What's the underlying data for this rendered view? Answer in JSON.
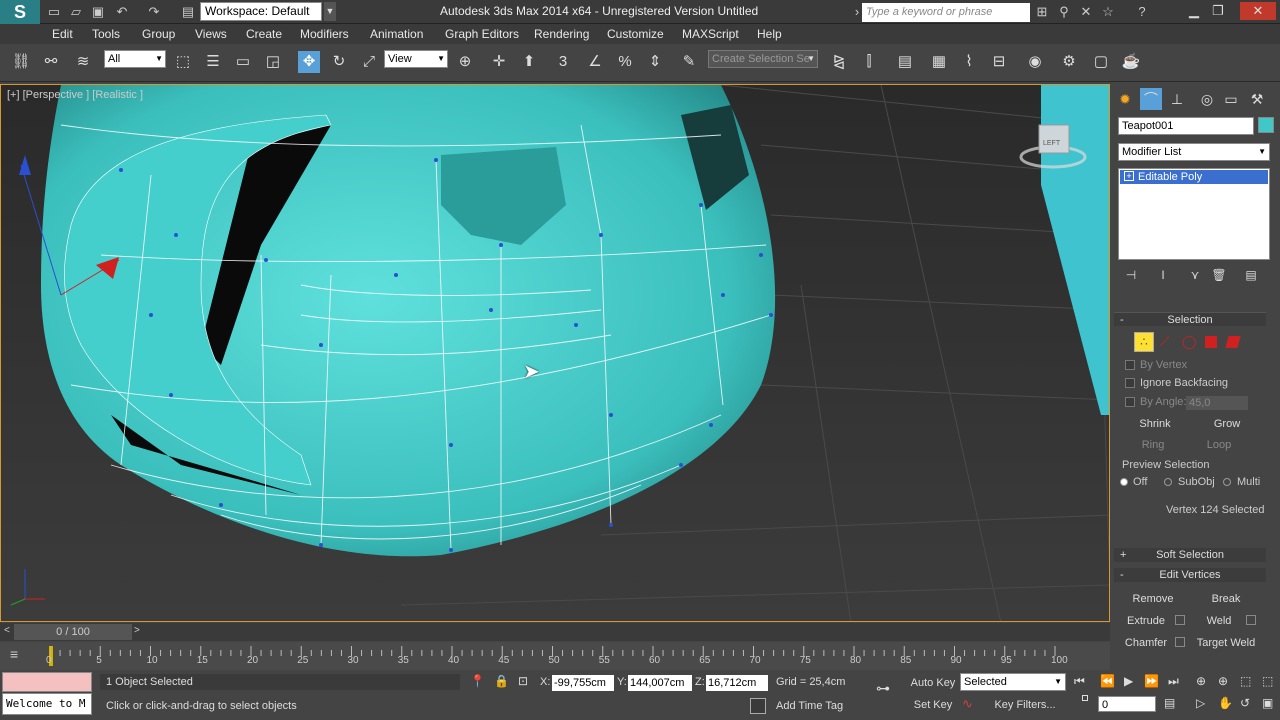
{
  "titlebar": {
    "workspace": "Workspace: Default",
    "title": "Autodesk 3ds Max  2014 x64    -  Unregistered Version    Untitled",
    "search_placeholder": "Type a keyword or phrase"
  },
  "menu": [
    "Edit",
    "Tools",
    "Group",
    "Views",
    "Create",
    "Modifiers",
    "Animation",
    "Graph Editors",
    "Rendering",
    "Customize",
    "MAXScript",
    "Help"
  ],
  "toolbar": {
    "filter": "All",
    "ref_coord": "View",
    "snap_label": "3",
    "selection_set_placeholder": "Create Selection Se"
  },
  "viewport": {
    "label": "[+] [Perspective ] [Realistic ]",
    "viewcube_face": "LEFT",
    "accent_color": "#40c8c8"
  },
  "command_panel": {
    "object_name": "Teapot001",
    "modifier_list": "Modifier List",
    "stack_item": "Editable Poly",
    "selection_title": "Selection",
    "by_vertex": "By Vertex",
    "ignore_backfacing": "Ignore Backfacing",
    "by_angle": "By Angle:",
    "angle_value": "45,0",
    "shrink": "Shrink",
    "grow": "Grow",
    "ring": "Ring",
    "loop": "Loop",
    "preview_selection": "Preview Selection",
    "preview_off": "Off",
    "preview_subobj": "SubObj",
    "preview_multi": "Multi",
    "selection_status": "Vertex 124 Selected",
    "soft_selection": "Soft Selection",
    "edit_vertices": "Edit Vertices",
    "remove": "Remove",
    "break": "Break",
    "extrude": "Extrude",
    "weld": "Weld",
    "chamfer": "Chamfer",
    "target_weld": "Target Weld"
  },
  "timeline": {
    "frame": "0 / 100",
    "ticks": [
      "0",
      "5",
      "10",
      "15",
      "20",
      "25",
      "30",
      "35",
      "40",
      "45",
      "50",
      "55",
      "60",
      "65",
      "70",
      "75",
      "80",
      "85",
      "90",
      "95",
      "100"
    ]
  },
  "status": {
    "welcome": "Welcome to M",
    "objects_selected": "1 Object Selected",
    "prompt": "Click or click-and-drag to select objects",
    "x_label": "X:",
    "x": "-99,755cm",
    "y_label": "Y:",
    "y": "144,007cm",
    "z_label": "Z:",
    "z": "16,712cm",
    "grid": "Grid = 25,4cm",
    "add_time_tag": "Add Time Tag",
    "auto_key": "Auto Key",
    "set_key": "Set Key",
    "key_mode": "Selected",
    "key_filters": "Key Filters...",
    "frame_field": "0"
  }
}
